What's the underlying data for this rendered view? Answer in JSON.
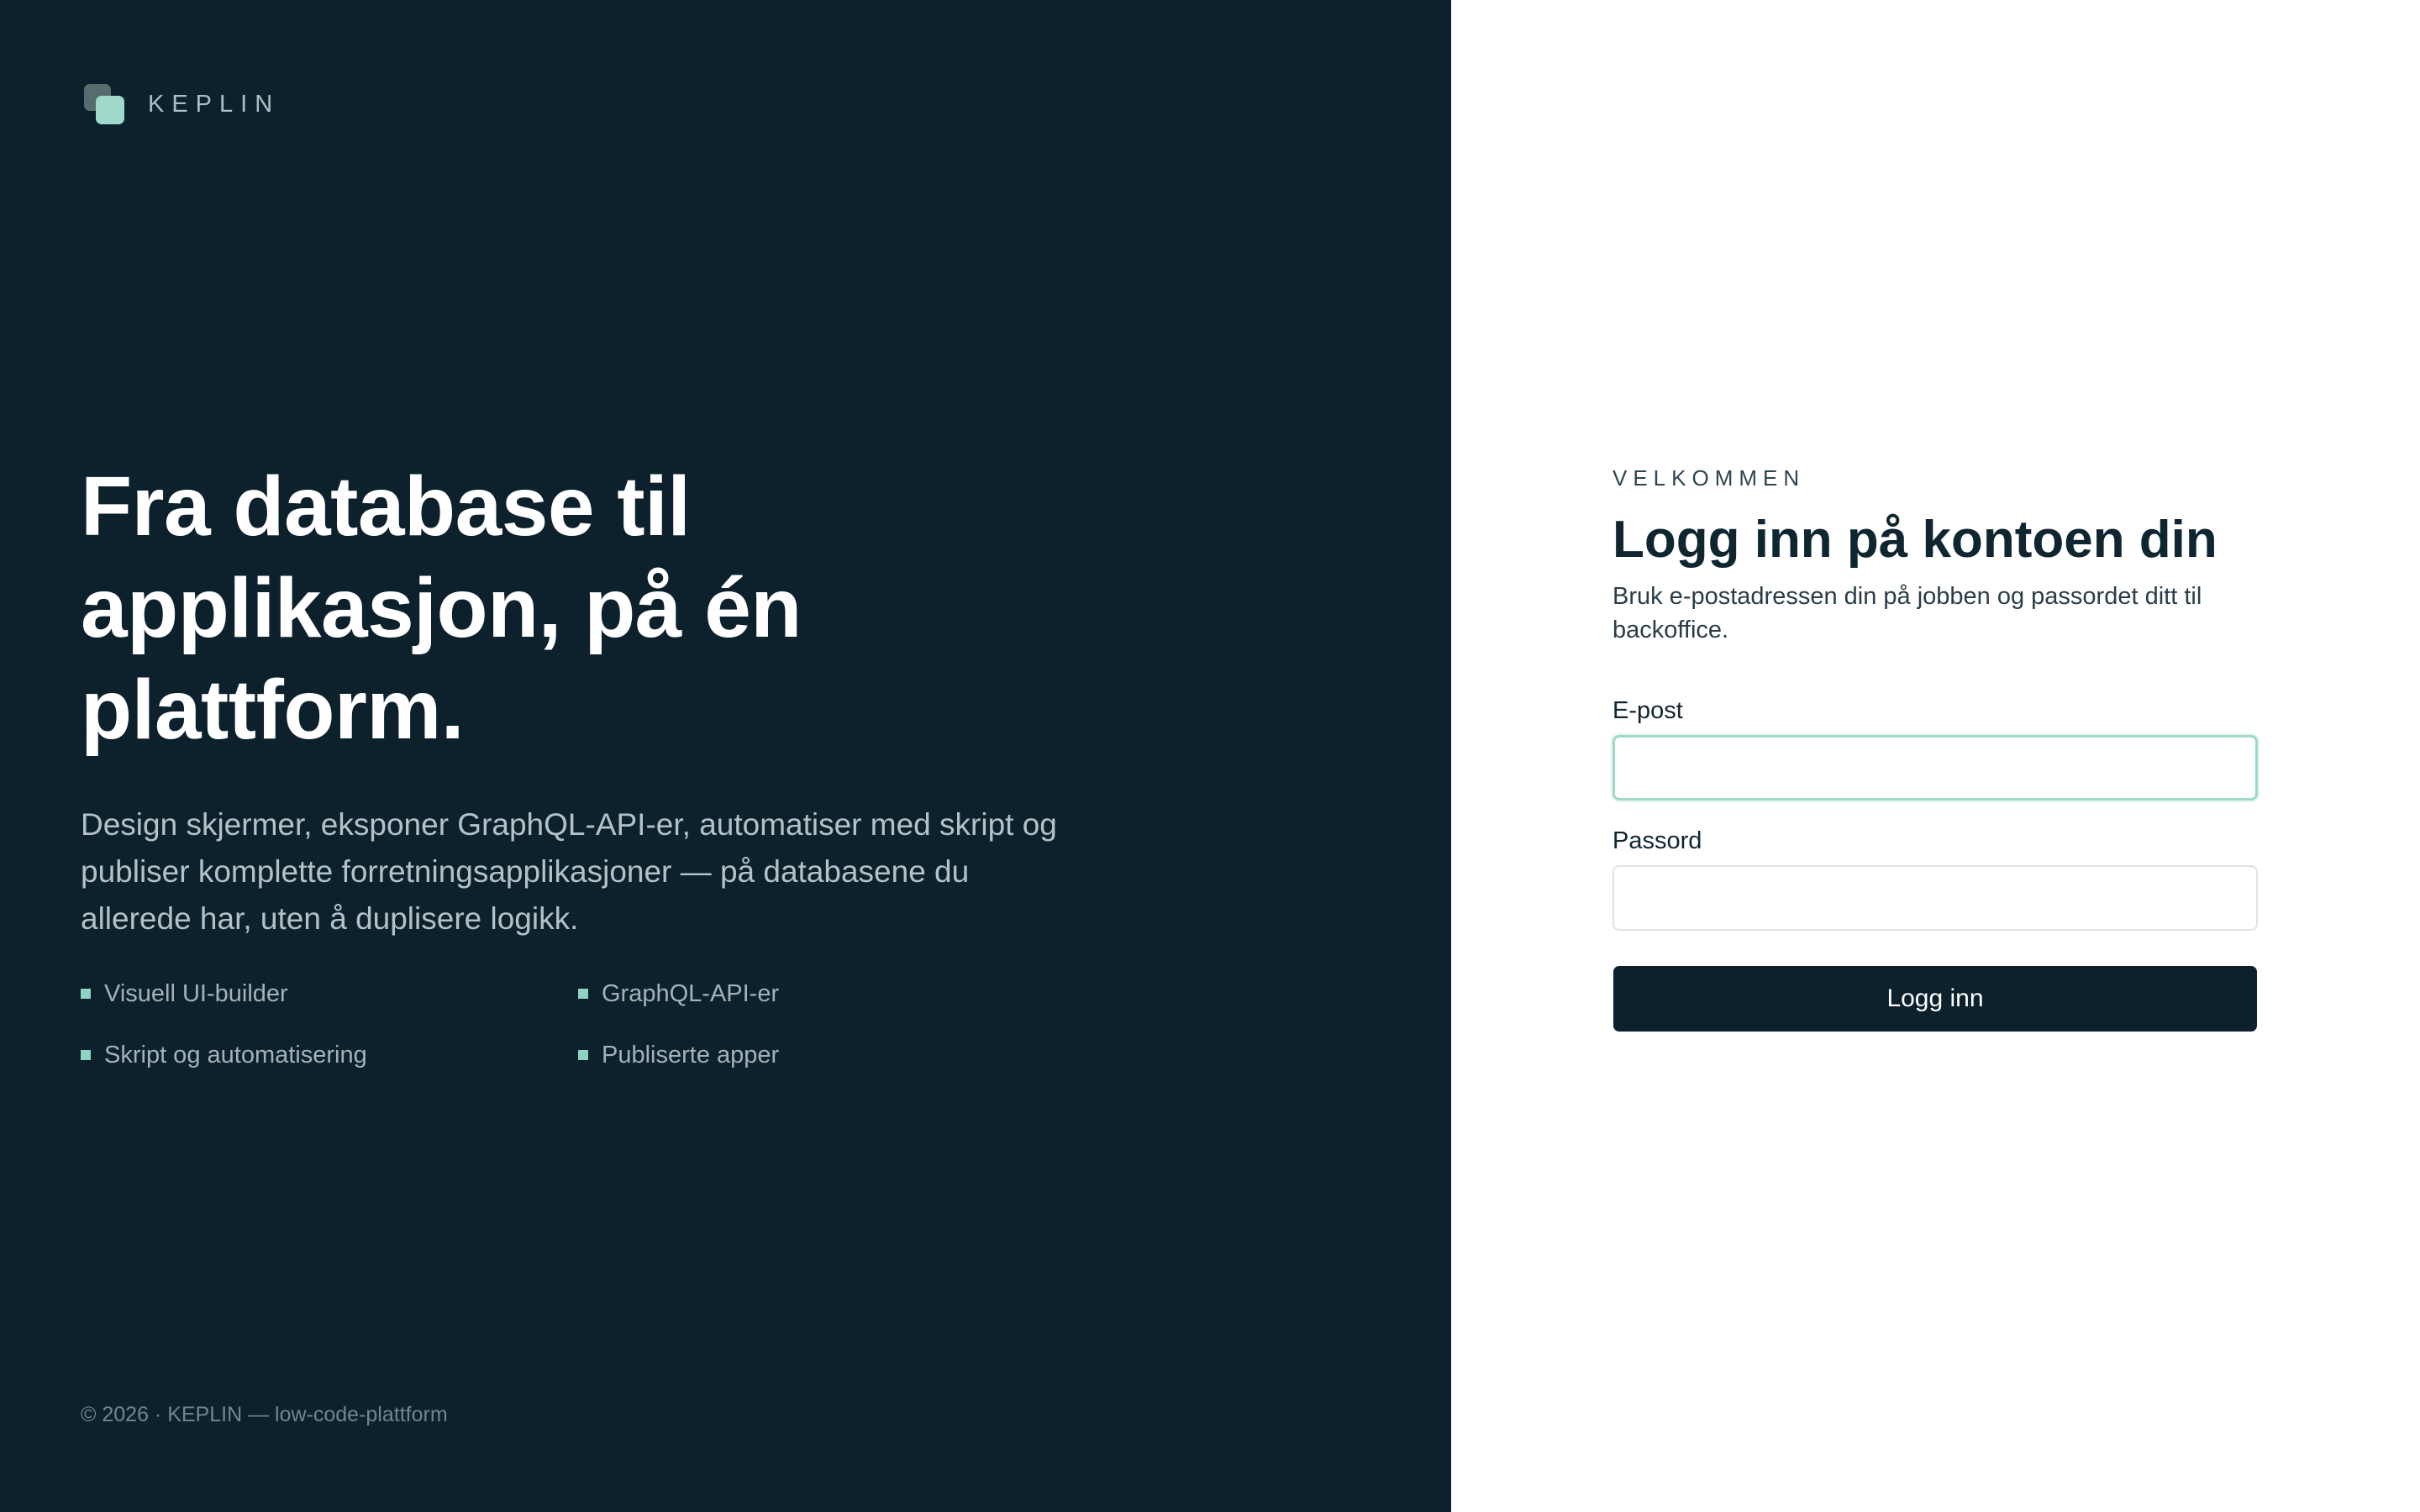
{
  "brand": {
    "name": "KEPLIN",
    "logo_icon": "stacked-squares-logo",
    "colors": {
      "panel_dark": "#0c212c",
      "accent": "#9fd9cb",
      "background_right": "#ffffff"
    }
  },
  "hero": {
    "title": "Fra database til applikasjon, på én plattform.",
    "description": "Design skjermer, eksponer GraphQL-API-er, automatiser med skript og publiser komplette forretningsapplikasjoner — på databasene du allerede har, uten å duplisere logikk."
  },
  "features": [
    {
      "label": "Visuell UI-builder"
    },
    {
      "label": "GraphQL-API-er"
    },
    {
      "label": "Skript og automatisering"
    },
    {
      "label": "Publiserte apper"
    }
  ],
  "footer": {
    "text": "© 2026 · KEPLIN — low-code-plattform"
  },
  "login": {
    "eyebrow": "VELKOMMEN",
    "title": "Logg inn på kontoen din",
    "subtitle": "Bruk e-postadressen din på jobben og passordet ditt til backoffice.",
    "email_label": "E-post",
    "email_value": "",
    "email_placeholder": "",
    "password_label": "Passord",
    "password_value": "",
    "password_placeholder": "",
    "submit_label": "Logg inn"
  }
}
